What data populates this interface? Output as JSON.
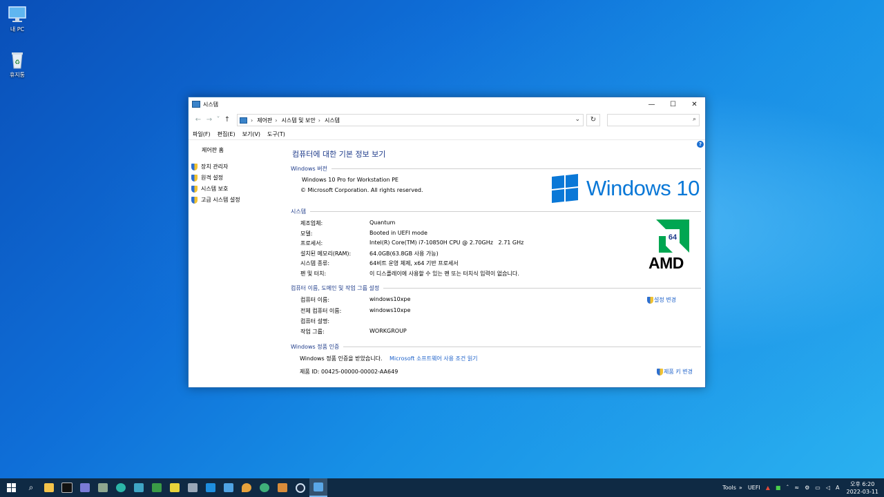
{
  "desktop": {
    "icons": [
      {
        "label": "내 PC"
      },
      {
        "label": "휴지통"
      }
    ]
  },
  "window": {
    "title": "시스템",
    "controls": {
      "minimize": "—",
      "maximize": "☐",
      "close": "✕"
    },
    "breadcrumbs": [
      "제어판",
      "시스템 및 보안",
      "시스템"
    ],
    "menu": [
      "파일(F)",
      "편집(E)",
      "보기(V)",
      "도구(T)"
    ],
    "left_pane": {
      "home": "제어판 홈",
      "links": [
        "장치 관리자",
        "원격 설정",
        "시스템 보호",
        "고급 시스템 설정"
      ]
    },
    "heading": "컴퓨터에 대한 기본 정보 보기",
    "edition": {
      "section": "Windows 버전",
      "name": "Windows 10 Pro for Workstation PE",
      "copyright": "© Microsoft Corporation. All rights reserved.",
      "logo_text": "Windows 10"
    },
    "system": {
      "section": "시스템",
      "rows": [
        {
          "label": "제조업체:",
          "value": "Quantum"
        },
        {
          "label": "모델:",
          "value": "Booted in UEFI mode"
        },
        {
          "label": "프로세서:",
          "value": "Intel(R) Core(TM) i7-10850H CPU @ 2.70GHz   2.71 GHz"
        },
        {
          "label": "설치된 메모리(RAM):",
          "value": "64.0GB(63.8GB 사용 가능)"
        },
        {
          "label": "시스템 종류:",
          "value": "64비트 운영 체제, x64 기반 프로세서"
        },
        {
          "label": "펜 및 터치:",
          "value": "이 디스플레이에 사용할 수 있는 펜 또는 터치식 입력이 없습니다."
        }
      ],
      "badge_number": "64",
      "brand": "AMD"
    },
    "computer": {
      "section": "컴퓨터 이름, 도메인 및 작업 그룹 설정",
      "rows": [
        {
          "label": "컴퓨터 이름:",
          "value": "windows10xpe"
        },
        {
          "label": "전체 컴퓨터 이름:",
          "value": "windows10xpe"
        },
        {
          "label": "컴퓨터 설명:",
          "value": ""
        },
        {
          "label": "작업 그룹:",
          "value": "WORKGROUP"
        }
      ],
      "change_link": "설정 변경"
    },
    "activation": {
      "section": "Windows 정품 인증",
      "status": "Windows 정품 인증을 받았습니다.",
      "terms_link": "Microsoft 소프트웨어 사용 조건 읽기",
      "product_id": "제품 ID: 00425-00000-00002-AA649",
      "change_key_link": "제품 키 변경"
    }
  },
  "taskbar": {
    "tray": {
      "tools": "Tools",
      "overflow": "»",
      "uefi": "UEFI",
      "ime": "A",
      "time": "오후 6:20",
      "date": "2022-03-11"
    },
    "colors": {
      "accent": "#0a78d7",
      "link": "#1a5fc9",
      "heading": "#1e3b8a",
      "amd_green": "#00a651"
    }
  }
}
